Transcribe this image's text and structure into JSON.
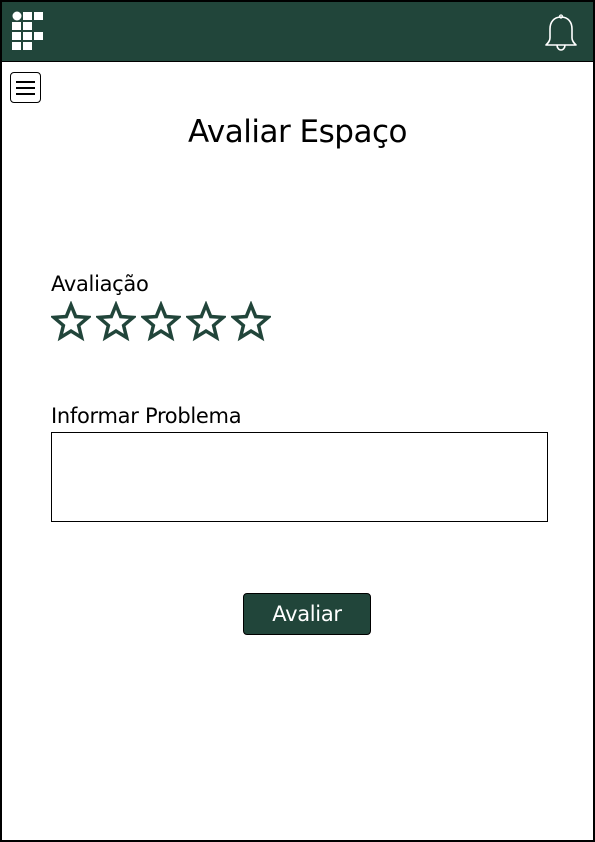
{
  "header": {
    "logo_icon": "institution-logo-icon",
    "notification_icon": "bell-icon",
    "background_color": "#21453a"
  },
  "menu": {
    "icon": "hamburger-menu-icon"
  },
  "page": {
    "title": "Avaliar Espaço"
  },
  "rating": {
    "label": "Avaliação",
    "max_stars": 5,
    "selected": 0,
    "star_color": "#21453a"
  },
  "problem": {
    "label": "Informar Problema",
    "value": ""
  },
  "submit": {
    "label": "Avaliar"
  }
}
